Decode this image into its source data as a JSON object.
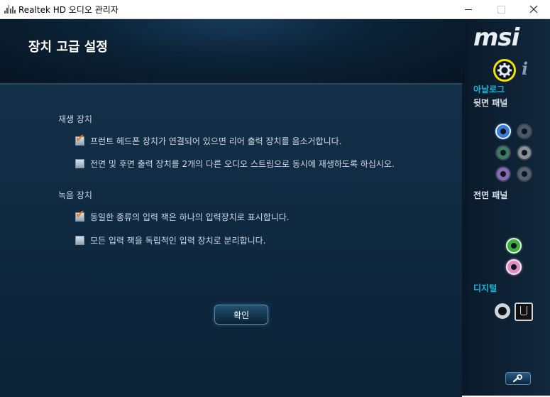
{
  "window": {
    "title": "Realtek HD 오디오 관리자"
  },
  "page": {
    "title": "장치 고급 설정"
  },
  "playback": {
    "section_label": "재생 장치",
    "options": [
      {
        "label": "프런트 헤드폰 장치가 연결되어 있으면 리어 출력 장치를 음소거합니다.",
        "checked": true
      },
      {
        "label": "전면 및 후면 출력 장치를 2개의 다른 오디오 스트림으로 동시에 재생하도록 하십시오.",
        "checked": false
      }
    ]
  },
  "recording": {
    "section_label": "녹음 장치",
    "options": [
      {
        "label": "동일한 종류의 입력 잭은 하나의 입력장치로 표시합니다.",
        "checked": true
      },
      {
        "label": "모든 입력 잭을 독립적인 입력 장치로 분리합니다.",
        "checked": false
      }
    ]
  },
  "ok_button": {
    "label": "확인"
  },
  "sidebar": {
    "logo": "msi",
    "info_glyph": "i",
    "analog_label": "아날로그",
    "rear_panel_label": "뒷면 패널",
    "front_panel_label": "전면 패널",
    "digital_label": "디지털"
  },
  "jacks": {
    "rear": [
      {
        "name": "blue",
        "color": "#3a7bd5",
        "active": true
      },
      {
        "name": "gray",
        "color": "#4a5866",
        "active": false
      },
      {
        "name": "green",
        "color": "#3e7a62",
        "active": false
      },
      {
        "name": "silver",
        "color": "#8a8f93",
        "active": false
      },
      {
        "name": "purple",
        "color": "#8a6ab8",
        "active": false
      },
      {
        "name": "dark-gray",
        "color": "#556270",
        "active": false
      }
    ],
    "front": [
      {
        "name": "green",
        "color": "#3fae3a",
        "active": true
      },
      {
        "name": "pink",
        "color": "#e48ac0",
        "active": true
      }
    ]
  },
  "colors": {
    "accent_cyan": "#19b4d8",
    "gear_highlight": "#f2e400",
    "checkmark_orange": "#e8791c"
  }
}
